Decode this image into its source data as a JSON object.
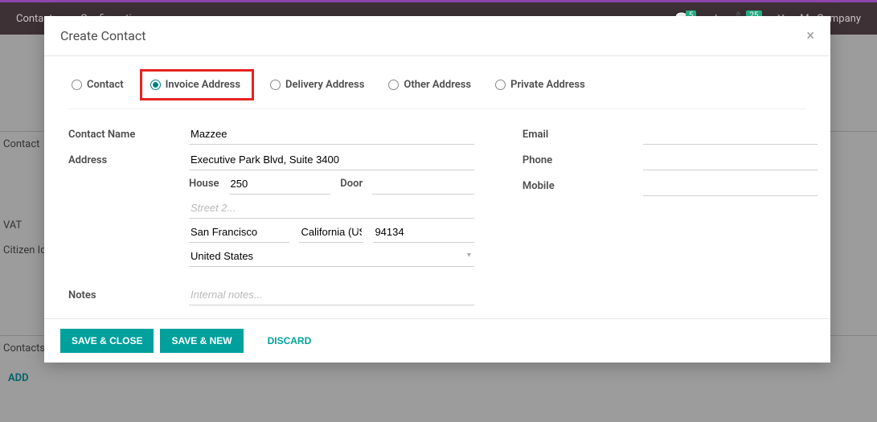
{
  "topbar": {
    "nav": [
      "Contacts",
      "Configuration"
    ],
    "msg_count": "5",
    "call_count": "25",
    "company_label": "My Company"
  },
  "bg": {
    "contact": "Contact",
    "vat": "VAT",
    "citizen": "Citizen Identification",
    "contacts_label": "Contacts",
    "add_label": "ADD"
  },
  "modal": {
    "title": "Create Contact",
    "radios": {
      "contact": "Contact",
      "invoice": "Invoice Address",
      "delivery": "Delivery Address",
      "other": "Other Address",
      "private": "Private Address"
    },
    "labels": {
      "contact_name": "Contact Name",
      "address": "Address",
      "house": "House",
      "door": "Door",
      "email": "Email",
      "phone": "Phone",
      "mobile": "Mobile",
      "notes": "Notes"
    },
    "values": {
      "contact_name": "Mazzee",
      "street": "Executive Park Blvd, Suite 3400",
      "house": "250",
      "door": "",
      "street2_placeholder": "Street 2...",
      "city": "San Francisco",
      "state": "California (US)",
      "zip": "94134",
      "country": "United States",
      "email": "",
      "phone": "",
      "mobile": "",
      "notes": "",
      "notes_placeholder": "Internal notes..."
    },
    "buttons": {
      "save_close": "SAVE & CLOSE",
      "save_new": "SAVE & NEW",
      "discard": "DISCARD"
    }
  }
}
